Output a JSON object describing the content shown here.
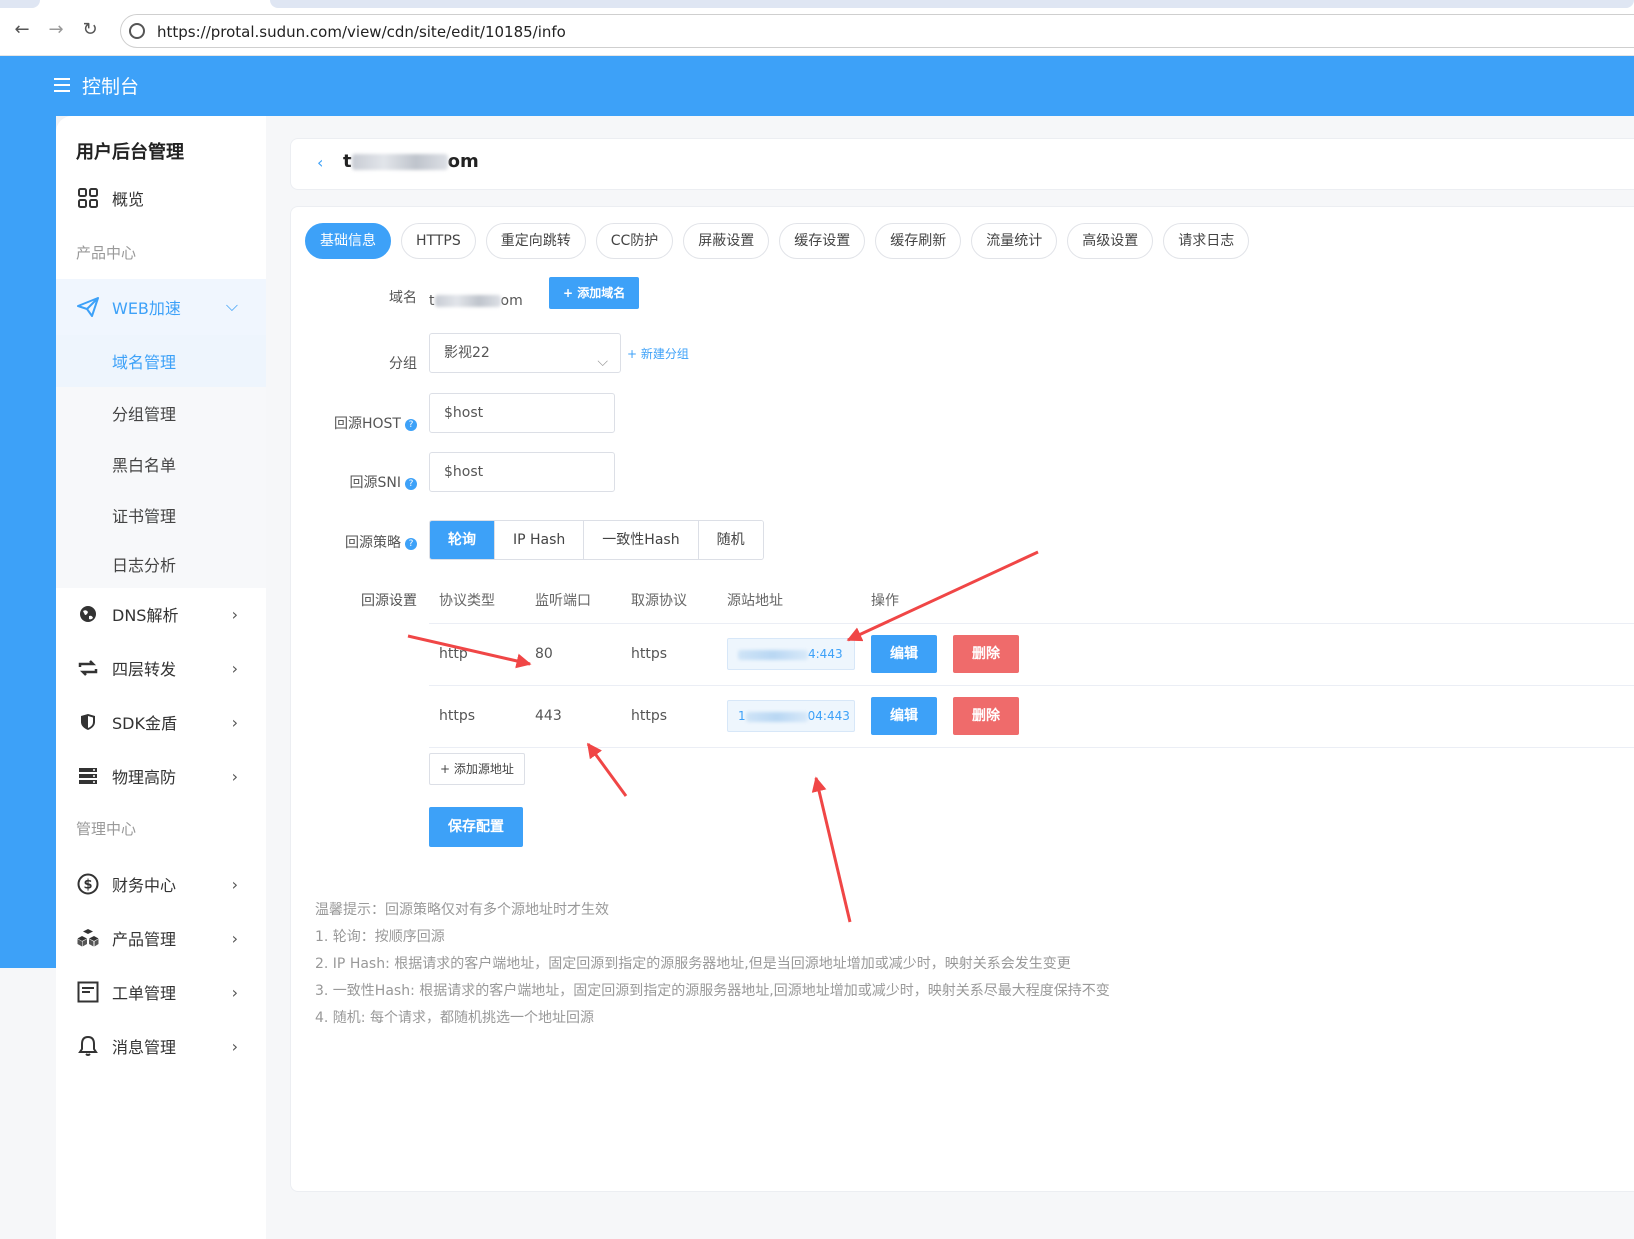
{
  "browser": {
    "url": "https://protal.sudun.com/view/cdn/site/edit/10185/info"
  },
  "header": {
    "title": "控制台"
  },
  "sidebar": {
    "title": "用户后台管理",
    "overview": "概览",
    "section_product": "产品中心",
    "web": "WEB加速",
    "web_subs": [
      "域名管理",
      "分组管理",
      "黑白名单",
      "证书管理",
      "日志分析"
    ],
    "items": [
      "DNS解析",
      "四层转发",
      "SDK金盾",
      "物理高防"
    ],
    "section_manage": "管理中心",
    "manage_items": [
      "财务中心",
      "产品管理",
      "工单管理",
      "消息管理"
    ]
  },
  "site": {
    "title_prefix": "t",
    "title_suffix": "om"
  },
  "tabs": [
    "基础信息",
    "HTTPS",
    "重定向跳转",
    "CC防护",
    "屏蔽设置",
    "缓存设置",
    "缓存刷新",
    "流量统计",
    "高级设置",
    "请求日志"
  ],
  "form": {
    "domain_label": "域名",
    "domain_prefix": "t",
    "domain_suffix": "om",
    "add_domain": "+ 添加域名",
    "group_label": "分组",
    "group_value": "影视22",
    "new_group": "+ 新建分组",
    "host_label": "回源HOST",
    "host_value": "$host",
    "sni_label": "回源SNI",
    "sni_value": "$host",
    "strategy_label": "回源策略",
    "strategies": [
      "轮询",
      "IP Hash",
      "一致性Hash",
      "随机"
    ],
    "origin_label": "回源设置"
  },
  "table": {
    "headers": [
      "协议类型",
      "监听端口",
      "取源协议",
      "源站地址",
      "操作"
    ],
    "rows": [
      {
        "protocol": "http",
        "port": "80",
        "origin_protocol": "https",
        "addr_prefix": "",
        "addr_suffix": "4:443"
      },
      {
        "protocol": "https",
        "port": "443",
        "origin_protocol": "https",
        "addr_prefix": "1",
        "addr_suffix": "04:443"
      }
    ],
    "edit_label": "编辑",
    "delete_label": "删除",
    "add_origin": "+ 添加源地址",
    "save": "保存配置"
  },
  "tips": [
    "温馨提示：回源策略仅对有多个源地址时才生效",
    "1. 轮询：按顺序回源",
    "2. IP Hash: 根据请求的客户端地址，固定回源到指定的源服务器地址,但是当回源地址增加或减少时，映射关系会发生变更",
    "3. 一致性Hash: 根据请求的客户端地址，固定回源到指定的源服务器地址,回源地址增加或减少时，映射关系尽最大程度保持不变",
    "4. 随机: 每个请求，都随机挑选一个地址回源"
  ],
  "colors": {
    "primary": "#3da1f8",
    "danger": "#ef6b6b",
    "annotation_arrow": "#f04646"
  }
}
